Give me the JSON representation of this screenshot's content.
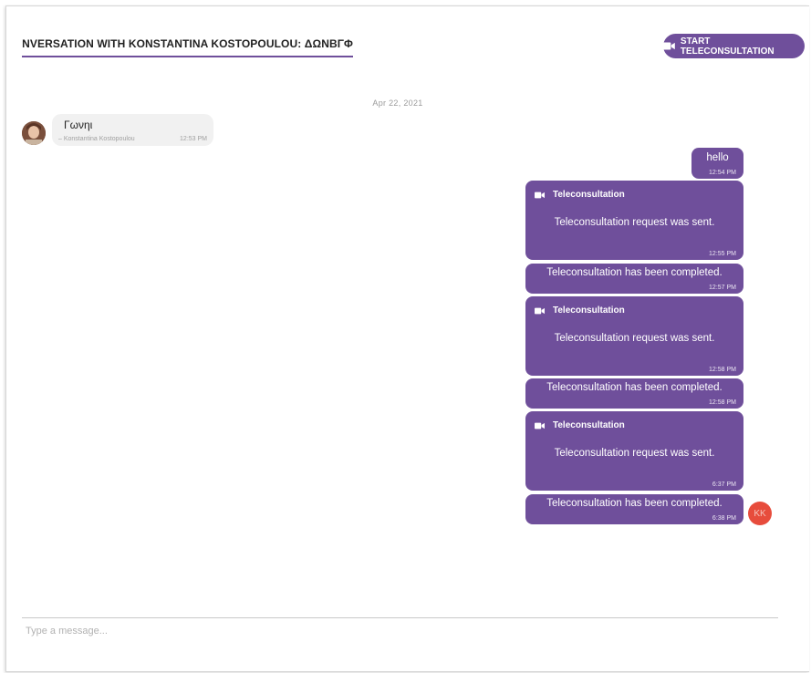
{
  "header": {
    "title": "CONVERSATION WITH KONSTANTINA KOSTOPOULOU: ΔΩΝΒΓΦ",
    "start_button_label": "START TELECONSULTATION",
    "start_button_icon": "video-camera-icon"
  },
  "date_divider": "Apr 22, 2021",
  "incoming": {
    "text": "Γωνηι",
    "sender": "– Konstantina Kostopoulou",
    "time": "12:53 PM"
  },
  "outgoing": [
    {
      "type": "text",
      "text": "hello",
      "time": "12:54 PM"
    },
    {
      "type": "teleconsultation",
      "title": "Teleconsultation",
      "text": "Teleconsultation request was sent.",
      "time": "12:55 PM"
    },
    {
      "type": "status",
      "text": "Teleconsultation has been completed.",
      "time": "12:57 PM"
    },
    {
      "type": "teleconsultation",
      "title": "Teleconsultation",
      "text": "Teleconsultation request was sent.",
      "time": "12:58 PM"
    },
    {
      "type": "status",
      "text": "Teleconsultation has been completed.",
      "time": "12:58 PM"
    },
    {
      "type": "teleconsultation",
      "title": "Teleconsultation",
      "text": "Teleconsultation request was sent.",
      "time": "6:37 PM"
    },
    {
      "type": "status",
      "text": "Teleconsultation has been completed.",
      "time": "6:38 PM"
    }
  ],
  "user_avatar_initials": "KK",
  "composer": {
    "placeholder": "Type a message..."
  },
  "colors": {
    "accent": "#6f4f9b",
    "avatar": "#e74c3c"
  }
}
